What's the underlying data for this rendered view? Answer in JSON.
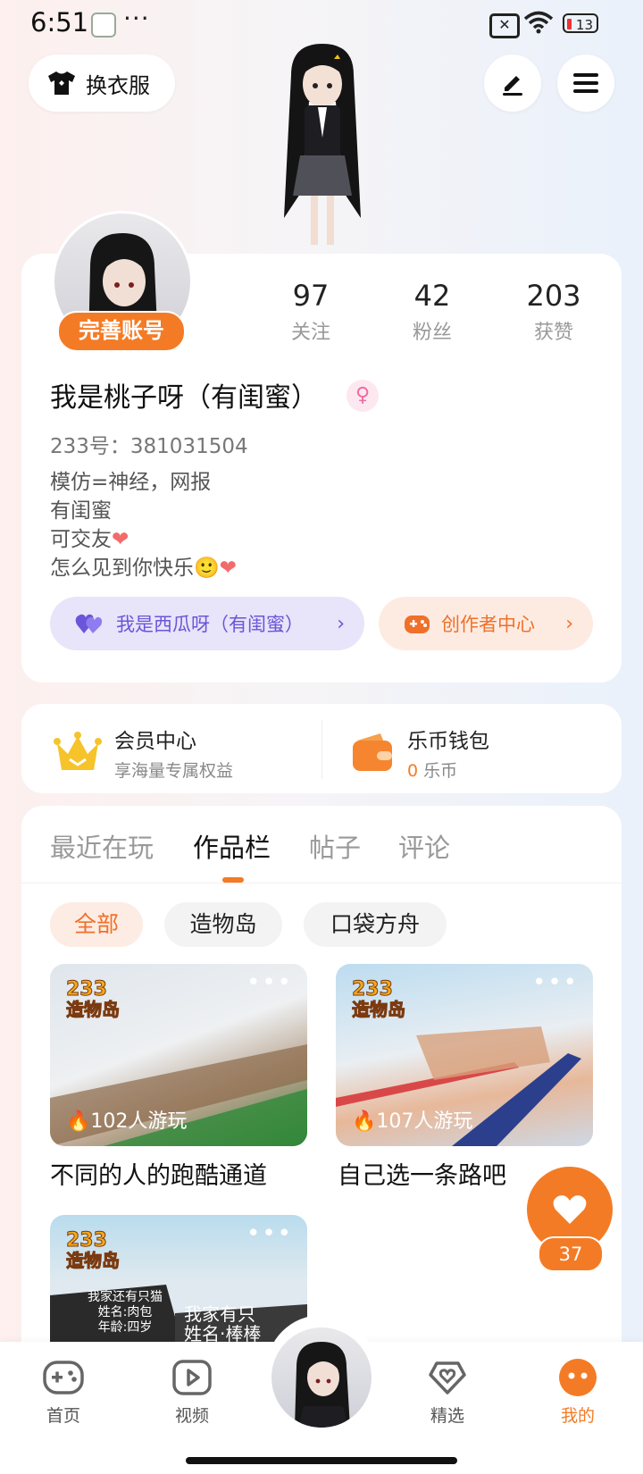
{
  "status_bar": {
    "time": "6:51",
    "dots": "···",
    "sim_label": "✕",
    "battery": "13"
  },
  "top": {
    "outfit_label": "换衣服"
  },
  "profile": {
    "complete_label": "完善账号",
    "stats": [
      {
        "num": "97",
        "label": "关注"
      },
      {
        "num": "42",
        "label": "粉丝"
      },
      {
        "num": "203",
        "label": "获赞"
      }
    ],
    "nickname": "我是桃子呀（有闺蜜）",
    "gender_symbol": "♀",
    "uid": "233号：381031504",
    "bio": [
      "模仿=神经，网报",
      "有闺蜜",
      "可交友",
      "怎么见到你快乐🙂"
    ],
    "friend_pill": "我是西瓜呀（有闺蜜）",
    "creator_pill": "创作者中心"
  },
  "member": {
    "vip_title": "会员中心",
    "vip_sub": "享海量专属权益",
    "wallet_title": "乐币钱包",
    "wallet_amount": "0",
    "wallet_unit": "乐币"
  },
  "tabs": [
    "最近在玩",
    "作品栏",
    "帖子",
    "评论"
  ],
  "chips": [
    "全部",
    "造物岛",
    "口袋方舟"
  ],
  "works": [
    {
      "badge_top": "233",
      "badge_bottom": "造物岛",
      "plays": "102人游玩",
      "title": "不同的人的跑酷通道"
    },
    {
      "badge_top": "233",
      "badge_bottom": "造物岛",
      "plays": "107人游玩",
      "title": "自己选一条路吧"
    },
    {
      "badge_top": "233",
      "badge_bottom": "造物岛",
      "sign1": [
        "我家还有只猫",
        "姓名:肉包",
        "年龄:四岁"
      ],
      "sign2": [
        "我家有只",
        "姓名·棒棒"
      ]
    }
  ],
  "like": {
    "count": "37"
  },
  "nav": [
    "首页",
    "视频",
    "精选",
    "我的"
  ],
  "colors": {
    "accent": "#f47b25",
    "purple": "#6b55d8",
    "purple_bg": "#e8e4fa"
  }
}
